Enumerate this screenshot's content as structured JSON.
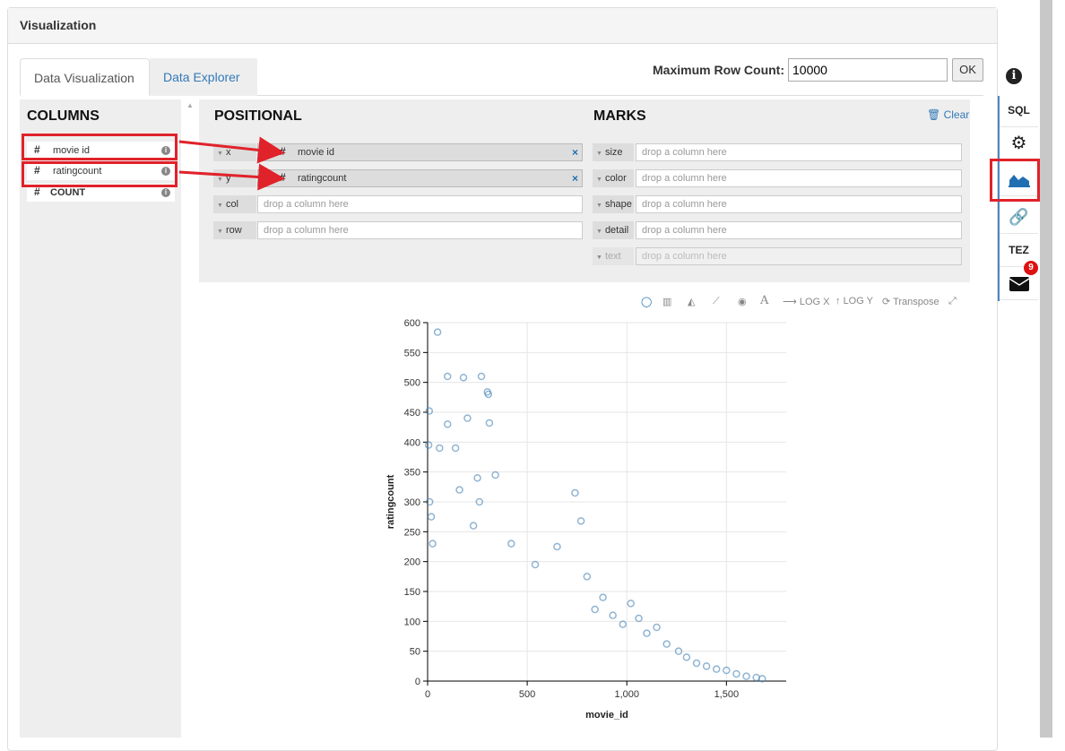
{
  "panel": {
    "title": "Visualization"
  },
  "tabs": [
    {
      "label": "Data Visualization",
      "active": true
    },
    {
      "label": "Data Explorer",
      "active": false
    }
  ],
  "row_count": {
    "label": "Maximum Row Count:",
    "value": "10000",
    "ok_label": "OK"
  },
  "columns": {
    "title": "COLUMNS",
    "items": [
      {
        "type_icon": "#",
        "label": "movie id",
        "info": "i"
      },
      {
        "type_icon": "#",
        "label": "ratingcount",
        "info": "i"
      },
      {
        "type_icon": "#",
        "label": "COUNT",
        "info": "i"
      }
    ]
  },
  "positional": {
    "title": "POSITIONAL",
    "shelves": [
      {
        "label": "x",
        "pill": {
          "type_icon": "#",
          "label": "movie id",
          "remove": "×"
        }
      },
      {
        "label": "y",
        "pill": {
          "type_icon": "#",
          "label": "ratingcount",
          "remove": "×"
        }
      },
      {
        "label": "col",
        "placeholder": "drop a column here"
      },
      {
        "label": "row",
        "placeholder": "drop a column here"
      }
    ]
  },
  "marks": {
    "title": "MARKS",
    "clear_label": "Clear",
    "shelves": [
      {
        "label": "size",
        "placeholder": "drop a column here"
      },
      {
        "label": "color",
        "placeholder": "drop a column here"
      },
      {
        "label": "shape",
        "placeholder": "drop a column here"
      },
      {
        "label": "detail",
        "placeholder": "drop a column here"
      },
      {
        "label": "text",
        "placeholder": "drop a column here",
        "disabled": true
      }
    ]
  },
  "toolbar": {
    "log_x": "LOG X",
    "log_y": "LOG Y",
    "transpose": "Transpose",
    "text_glyph": "A"
  },
  "sidebar": {
    "sql": "SQL",
    "tez": "TEZ",
    "message_count": "9"
  },
  "colors": {
    "accent": "#337ab7",
    "highlight": "#e0222a",
    "point": "#4682b4"
  },
  "chart_data": {
    "type": "scatter",
    "xlabel": "movie_id",
    "ylabel": "ratingcount",
    "xlim": [
      0,
      1800
    ],
    "ylim": [
      0,
      600
    ],
    "xticks": [
      "0",
      "500",
      "1,000",
      "1,500"
    ],
    "yticks": [
      "0",
      "50",
      "100",
      "150",
      "200",
      "250",
      "300",
      "350",
      "400",
      "450",
      "500",
      "550",
      "600"
    ],
    "grid": true,
    "series": [
      {
        "x": [
          50,
          100,
          180,
          270,
          300,
          305,
          310,
          8,
          5,
          10,
          18,
          25,
          60,
          100,
          140,
          160,
          200,
          230,
          250,
          260,
          340,
          420,
          540,
          650,
          740,
          770,
          800,
          840,
          880,
          930,
          980,
          1020,
          1060,
          1100,
          1150,
          1200,
          1260,
          1300,
          1350,
          1400,
          1450,
          1500,
          1550,
          1600,
          1650,
          1680
        ],
        "y": [
          584,
          510,
          508,
          510,
          484,
          480,
          432,
          452,
          395,
          300,
          275,
          230,
          390,
          430,
          390,
          320,
          440,
          260,
          340,
          300,
          345,
          230,
          195,
          225,
          315,
          268,
          175,
          120,
          140,
          110,
          95,
          130,
          105,
          80,
          90,
          62,
          50,
          40,
          30,
          25,
          20,
          18,
          12,
          8,
          6,
          4
        ]
      }
    ]
  }
}
